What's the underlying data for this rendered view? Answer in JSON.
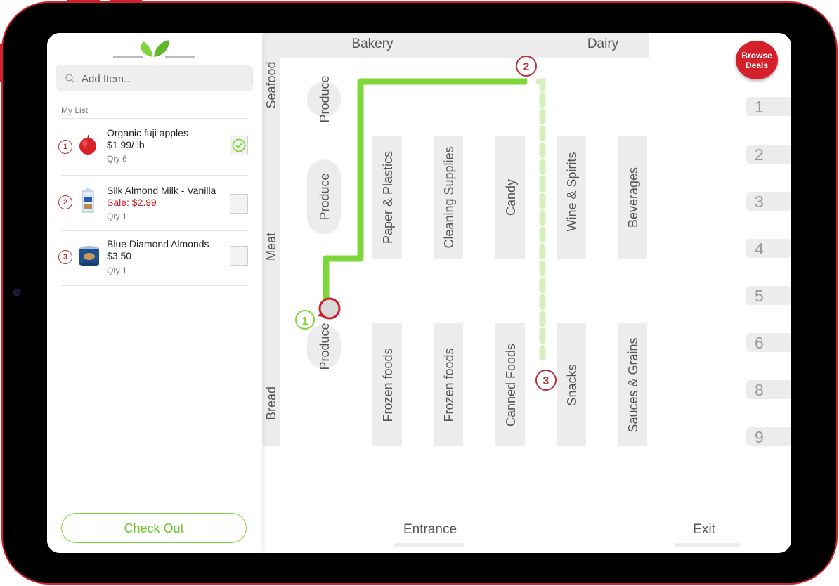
{
  "sidebar": {
    "search_placeholder": "Add Item...",
    "list_title": "My List",
    "items": [
      {
        "num": "1",
        "name": "Organic fuji apples",
        "price": "$1.99/ lb",
        "qty": "Qty 6",
        "checked": true,
        "image": "apple"
      },
      {
        "num": "2",
        "name": "Silk Almond Milk - Vanilla",
        "price": "Sale: $2.99",
        "qty": "Qty 1",
        "checked": false,
        "image": "almond-milk-carton"
      },
      {
        "num": "3",
        "name": "Blue Diamond Almonds",
        "price": "$3.50",
        "qty": "Qty 1",
        "checked": false,
        "image": "almond-can"
      }
    ],
    "checkout_label": "Check Out"
  },
  "header": {
    "browse_line1": "Browse",
    "browse_line2": "Deals"
  },
  "map": {
    "top_sections": [
      "Bakery",
      "Dairy"
    ],
    "left_sections": [
      "Seafood",
      "Meat",
      "Bread"
    ],
    "produce_label": "Produce",
    "upper_aisles": [
      "Paper & Plastics",
      "Cleaning Supplies",
      "Candy",
      "Wine & Spirits",
      "Beverages"
    ],
    "lower_aisles": [
      "Frozen foods",
      "Frozen foods",
      "Canned Foods",
      "Snacks",
      "Sauces & Grains"
    ],
    "aisle_numbers": [
      "1",
      "2",
      "3",
      "4",
      "5",
      "6",
      "8",
      "9"
    ],
    "route_stops": [
      "1",
      "2",
      "3"
    ],
    "entrance": "Entrance",
    "exit": "Exit"
  },
  "colors": {
    "brand_red": "#d3202a",
    "route_green": "#7dd63a",
    "route_pending": "#d6f0bd",
    "stop_marker": "#b5333a",
    "shelf_gray": "#ececec"
  }
}
